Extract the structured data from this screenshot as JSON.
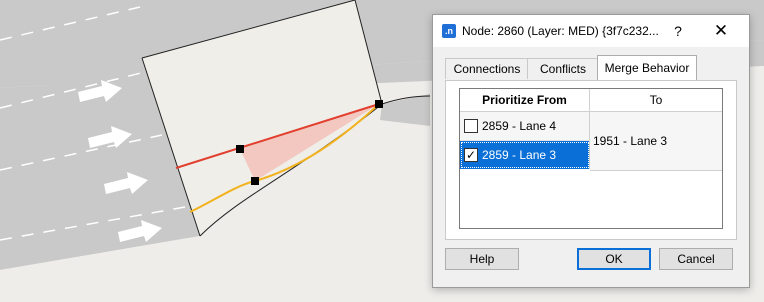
{
  "dialog": {
    "title": "Node: 2860 (Layer: MED) {3f7c232...",
    "app_icon_text": ".n",
    "help_glyph": "?",
    "close_glyph": "✕",
    "tabs": [
      {
        "label": "Connections",
        "active": false
      },
      {
        "label": "Conflicts",
        "active": false
      },
      {
        "label": "Merge Behavior",
        "active": true
      }
    ],
    "grid": {
      "col_from": "Prioritize From",
      "col_to": "To",
      "rows": [
        {
          "label": "2859 - Lane 4",
          "checked": false,
          "check_glyph": "",
          "selected": false
        },
        {
          "label": "2859 - Lane 3",
          "checked": true,
          "check_glyph": "✓",
          "selected": true
        }
      ],
      "to_value": "1951 - Lane 3"
    },
    "buttons": {
      "help": "Help",
      "ok": "OK",
      "cancel": "Cancel"
    }
  },
  "canvas": {
    "colors": {
      "road": "#c9c9c9",
      "road_dark": "#bdbdbd",
      "node_area": "#efeee9",
      "background": "#efedea",
      "lane_red": "#e2402f",
      "lane_orange": "#f2b21e",
      "merge_fill": "#f3c8c0",
      "arrow": "#ffffff"
    }
  }
}
